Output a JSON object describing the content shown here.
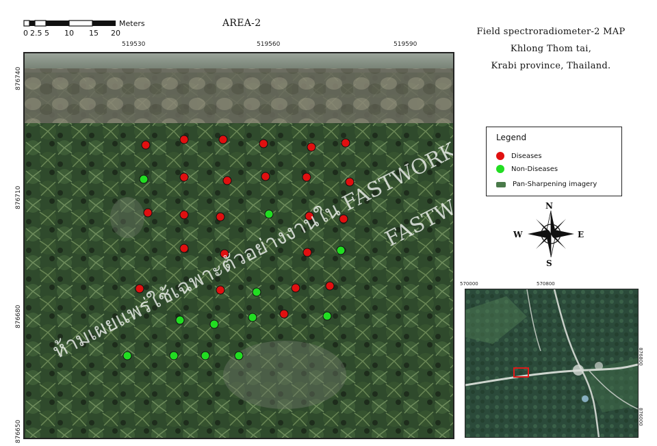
{
  "scale_bar": {
    "ticks": [
      "0",
      "2.5",
      "5",
      "10",
      "15",
      "20"
    ],
    "unit": "Meters"
  },
  "area_title": "AREA-2",
  "map_title": {
    "line1": "Field spectroradiometer-2 MAP",
    "line2": "Khlong Thom tai,",
    "line3": "Krabi province, Thailand."
  },
  "grid": {
    "x_ticks": [
      "519530",
      "519560",
      "519590"
    ],
    "y_ticks": [
      "876740",
      "876710",
      "876680",
      "876650"
    ]
  },
  "legend": {
    "title": "Legend",
    "items": [
      {
        "label": "Diseases",
        "color": "#e01010"
      },
      {
        "label": "Non-Diseases",
        "color": "#22dd22"
      },
      {
        "label": "Pan-Sharpening imagery",
        "color": "#4a7a4a"
      }
    ]
  },
  "compass": {
    "n": "N",
    "s": "S",
    "e": "E",
    "w": "W"
  },
  "inset": {
    "x_ticks": [
      "570000",
      "570800"
    ],
    "y_ticks": [
      "876800",
      "876000"
    ]
  },
  "points": {
    "diseases": [
      [
        213,
        212
      ],
      [
        269,
        204
      ],
      [
        326,
        204
      ],
      [
        385,
        210
      ],
      [
        455,
        215
      ],
      [
        505,
        209
      ],
      [
        269,
        259
      ],
      [
        332,
        264
      ],
      [
        388,
        258
      ],
      [
        448,
        259
      ],
      [
        511,
        266
      ],
      [
        216,
        311
      ],
      [
        269,
        314
      ],
      [
        322,
        317
      ],
      [
        452,
        316
      ],
      [
        502,
        320
      ],
      [
        269,
        363
      ],
      [
        328,
        371
      ],
      [
        449,
        369
      ],
      [
        204,
        422
      ],
      [
        322,
        424
      ],
      [
        432,
        421
      ],
      [
        482,
        418
      ],
      [
        415,
        459
      ]
    ],
    "non_diseases": [
      [
        210,
        262
      ],
      [
        393,
        313
      ],
      [
        498,
        366
      ],
      [
        375,
        427
      ],
      [
        263,
        468
      ],
      [
        313,
        474
      ],
      [
        369,
        464
      ],
      [
        478,
        462
      ],
      [
        186,
        520
      ],
      [
        254,
        520
      ],
      [
        300,
        520
      ],
      [
        349,
        520
      ]
    ]
  },
  "watermark": {
    "line1": "FASTWORK เท่านั้น",
    "line2": "ห้ามเผยแพร่ใช้เฉพาะตัวอย่างงานใน FASTWORK"
  }
}
